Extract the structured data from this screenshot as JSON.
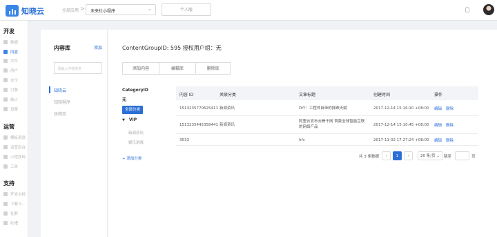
{
  "app": {
    "name": "知晓云"
  },
  "topbar": {
    "breadcrumb": "全部应用",
    "breadcrumb_sep": ">",
    "app_select": "未来社小程序",
    "edition": "个人版"
  },
  "sidebar": {
    "sections": [
      {
        "title": "开发",
        "items": [
          {
            "label": "数据",
            "icon": "database-icon"
          },
          {
            "label": "内容",
            "icon": "content-icon",
            "active": true
          },
          {
            "label": "文件",
            "icon": "file-icon"
          },
          {
            "label": "用户",
            "icon": "user-icon"
          },
          {
            "label": "支付",
            "icon": "payment-icon"
          },
          {
            "label": "引擎",
            "icon": "engine-icon"
          },
          {
            "label": "统计",
            "icon": "stats-icon"
          },
          {
            "label": "设置",
            "icon": "gear-icon"
          }
        ]
      },
      {
        "title": "运营",
        "items": [
          {
            "label": "模板消息",
            "icon": "message-icon"
          },
          {
            "label": "运营后台",
            "icon": "admin-icon"
          },
          {
            "label": "小程序码",
            "icon": "qrcode-icon"
          },
          {
            "label": "工具",
            "icon": "tool-icon"
          }
        ]
      },
      {
        "title": "支持",
        "items": [
          {
            "label": "开发文档",
            "icon": "doc-icon"
          },
          {
            "label": "下载 S...",
            "icon": "download-icon"
          },
          {
            "label": "社群",
            "icon": "community-icon"
          },
          {
            "label": "吐槽",
            "icon": "feedback-icon"
          }
        ]
      }
    ]
  },
  "library": {
    "title": "内容库",
    "add_label": "添加",
    "search_placeholder": "请输入内容库名",
    "items": [
      "知晓云",
      "知晓程序",
      "玩物志"
    ]
  },
  "content": {
    "heading": "ContentGroupID: 595   授权用户组：无",
    "actions": [
      "添加内容",
      "编辑库",
      "删除库"
    ],
    "category": {
      "title": "CategoryID",
      "none": "无",
      "all": "全部分类",
      "vip": "VIP",
      "vip_children": [
        "新闻资讯",
        "娱乐游戏"
      ],
      "add": "+ 添加分类"
    },
    "table": {
      "headers": [
        "内容 ID",
        "关联分类",
        "文章标题",
        "创建时间",
        "操作"
      ],
      "rows": [
        {
          "id": "1513235770625411",
          "category": "新闻资讯",
          "title": "DIY：工程师自带的摔跌天赋",
          "created": "2017-12-14 15:16:10 +08:00",
          "edit": "编辑",
          "delete": "删除"
        },
        {
          "id": "1513235445358441",
          "category": "新闻资讯",
          "title": "阿里云发布云骨干网 首款全球智能互联的网络产品",
          "created": "2017-12-14 15:10:45 +08:00",
          "edit": "编辑",
          "delete": "删除"
        },
        {
          "id": "3533",
          "category": "",
          "title": "hfv",
          "created": "2017-11-02 17:27:24 +08:00",
          "edit": "编辑",
          "delete": "删除"
        }
      ]
    },
    "pagination": {
      "total": "共 3 条数据",
      "prev": "‹",
      "current": "1",
      "next": "›",
      "page_size": "20 条/页",
      "jump": "跳至",
      "page_unit": "页"
    }
  },
  "colors": {
    "accent": "#2b6fd6"
  }
}
